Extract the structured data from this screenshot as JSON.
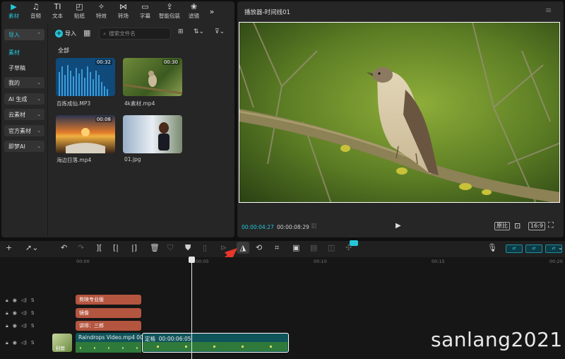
{
  "media_tabs": [
    {
      "label": "素材",
      "icon": "media-icon",
      "active": true
    },
    {
      "label": "音频",
      "icon": "audio-icon"
    },
    {
      "label": "文本",
      "icon": "text-icon"
    },
    {
      "label": "贴纸",
      "icon": "sticker-icon"
    },
    {
      "label": "特效",
      "icon": "effects-icon"
    },
    {
      "label": "转场",
      "icon": "transition-icon"
    },
    {
      "label": "字幕",
      "icon": "caption-icon"
    },
    {
      "label": "智能包装",
      "icon": "smart-pack-icon"
    },
    {
      "label": "滤镜",
      "icon": "filter-icon"
    }
  ],
  "sidebar": {
    "import": "导入",
    "material": "素材",
    "sub_draft": "子草稿",
    "mine": "我的",
    "ai_gen": "AI 生成",
    "cloud": "云素材",
    "official": "官方素材",
    "jimeng": "即梦AI"
  },
  "library": {
    "import_btn": "导入",
    "search_placeholder": "搜索文件名",
    "all_label": "全部",
    "items": [
      {
        "name": "百炼成仙.MP3",
        "duration": "00:32"
      },
      {
        "name": "4k素材.mp4",
        "duration": "00:30"
      },
      {
        "name": "海边日落.mp4",
        "duration": "00:08"
      },
      {
        "name": "01.jpg",
        "duration": ""
      }
    ]
  },
  "player": {
    "title": "播放器-时间线01",
    "current_time": "00:00:04:27",
    "total_time": "00:00:08:29",
    "ratio": "16:9",
    "fit_label": "原比"
  },
  "toolbar": {
    "mirror_tooltip": "镜像"
  },
  "timeline": {
    "ticks": [
      "00:00",
      "00:05",
      "00:10",
      "00:15",
      "00:20"
    ],
    "text_clips": [
      "剪映专业版",
      "镜像",
      "讲师：三郎"
    ],
    "cover_label": "封面",
    "clip_a_label": "Raindrops Video.mp4",
    "clip_a_time": "00",
    "clip_b_label": "定格",
    "clip_b_time": "00:00:06:05"
  },
  "watermark": "sanlang2021"
}
